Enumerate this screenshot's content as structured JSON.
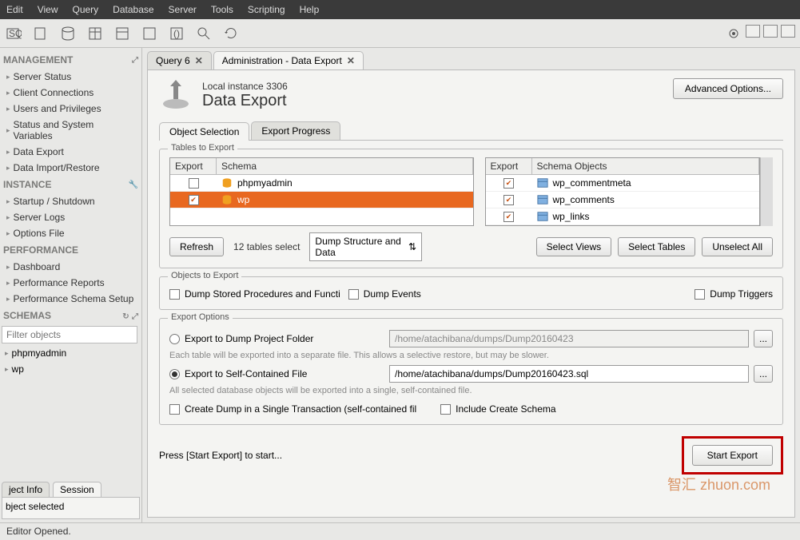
{
  "menu": [
    "Edit",
    "View",
    "Query",
    "Database",
    "Server",
    "Tools",
    "Scripting",
    "Help"
  ],
  "sidebar": {
    "management": {
      "title": "MANAGEMENT",
      "items": [
        "Server Status",
        "Client Connections",
        "Users and Privileges",
        "Status and System Variables",
        "Data Export",
        "Data Import/Restore"
      ]
    },
    "instance": {
      "title": "INSTANCE",
      "items": [
        "Startup / Shutdown",
        "Server Logs",
        "Options File"
      ]
    },
    "performance": {
      "title": "PERFORMANCE",
      "items": [
        "Dashboard",
        "Performance Reports",
        "Performance Schema Setup"
      ]
    },
    "schemas": {
      "title": "SCHEMAS",
      "filter_placeholder": "Filter objects",
      "items": [
        "phpmyadmin",
        "wp"
      ]
    }
  },
  "tabs": [
    {
      "label": "Query 6",
      "active": false
    },
    {
      "label": "Administration - Data Export",
      "active": true
    }
  ],
  "header": {
    "subtitle": "Local instance 3306",
    "title": "Data Export",
    "advanced": "Advanced Options..."
  },
  "subtabs": [
    {
      "label": "Object Selection",
      "active": true
    },
    {
      "label": "Export Progress",
      "active": false
    }
  ],
  "tables_section": {
    "legend": "Tables to Export",
    "schema_head": [
      "Export",
      "Schema"
    ],
    "schemas": [
      {
        "checked": false,
        "name": "phpmyadmin",
        "selected": false
      },
      {
        "checked": true,
        "name": "wp",
        "selected": true
      }
    ],
    "objects_head": [
      "Export",
      "Schema Objects"
    ],
    "objects": [
      {
        "checked": true,
        "name": "wp_commentmeta"
      },
      {
        "checked": true,
        "name": "wp_comments"
      },
      {
        "checked": true,
        "name": "wp_links"
      }
    ],
    "refresh": "Refresh",
    "count": "12 tables select",
    "dump_mode": "Dump Structure and Data",
    "select_views": "Select Views",
    "select_tables": "Select Tables",
    "unselect_all": "Unselect All"
  },
  "objects_section": {
    "legend": "Objects to Export",
    "opts": [
      "Dump Stored Procedures and Functi",
      "Dump Events",
      "Dump Triggers"
    ]
  },
  "export_options": {
    "legend": "Export Options",
    "radio1": "Export to Dump Project Folder",
    "path1": "/home/atachibana/dumps/Dump20160423",
    "hint1": "Each table will be exported into a separate file. This allows a selective restore, but may be slower.",
    "radio2": "Export to Self-Contained File",
    "path2": "/home/atachibana/dumps/Dump20160423.sql",
    "hint2": "All selected database objects will be exported into a single, self-contained file.",
    "chk1": "Create Dump in a Single Transaction (self-contained fil",
    "chk2": "Include Create Schema"
  },
  "footer": {
    "press": "Press [Start Export] to start...",
    "start": "Start Export"
  },
  "bottom_tabs": [
    "ject Info",
    "Session"
  ],
  "bottom_msg": "bject selected",
  "status": "Editor Opened.",
  "watermark": "智汇 zhuon.com"
}
